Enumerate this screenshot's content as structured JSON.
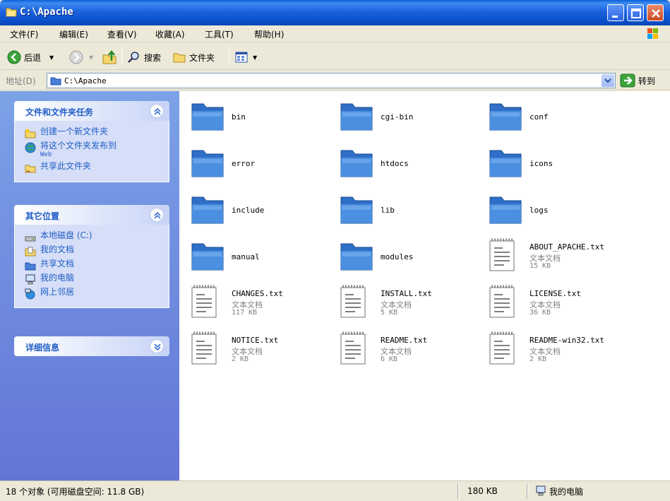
{
  "window": {
    "title": "C:\\Apache"
  },
  "menu": [
    {
      "label": "文件(F)"
    },
    {
      "label": "编辑(E)"
    },
    {
      "label": "查看(V)"
    },
    {
      "label": "收藏(A)"
    },
    {
      "label": "工具(T)"
    },
    {
      "label": "帮助(H)"
    }
  ],
  "toolbar": {
    "back_label": "后退",
    "search_label": "搜索",
    "folders_label": "文件夹"
  },
  "address": {
    "label": "地址(D)",
    "value": "C:\\Apache",
    "go_label": "转到"
  },
  "tasks_panel": {
    "title": "文件和文件夹任务",
    "items": [
      {
        "label": "创建一个新文件夹",
        "icon": "new-folder-icon"
      },
      {
        "label": "将这个文件夹发布到",
        "sub": "Web",
        "icon": "publish-web-icon"
      },
      {
        "label": "共享此文件夹",
        "icon": "share-folder-icon"
      }
    ]
  },
  "places_panel": {
    "title": "其它位置",
    "items": [
      {
        "label": "本地磁盘 (C:)",
        "icon": "local-disk-icon"
      },
      {
        "label": "我的文档",
        "icon": "my-documents-icon"
      },
      {
        "label": "共享文档",
        "icon": "shared-documents-icon"
      },
      {
        "label": "我的电脑",
        "icon": "my-computer-icon"
      },
      {
        "label": "网上邻居",
        "icon": "network-places-icon"
      }
    ]
  },
  "details_panel": {
    "title": "详细信息"
  },
  "files": [
    {
      "name": "bin",
      "kind": "folder"
    },
    {
      "name": "cgi-bin",
      "kind": "folder"
    },
    {
      "name": "conf",
      "kind": "folder"
    },
    {
      "name": "error",
      "kind": "folder"
    },
    {
      "name": "htdocs",
      "kind": "folder"
    },
    {
      "name": "icons",
      "kind": "folder"
    },
    {
      "name": "include",
      "kind": "folder"
    },
    {
      "name": "lib",
      "kind": "folder"
    },
    {
      "name": "logs",
      "kind": "folder"
    },
    {
      "name": "manual",
      "kind": "folder"
    },
    {
      "name": "modules",
      "kind": "folder"
    },
    {
      "name": "ABOUT_APACHE.txt",
      "kind": "file",
      "type": "文本文档",
      "size": "15 KB"
    },
    {
      "name": "CHANGES.txt",
      "kind": "file",
      "type": "文本文档",
      "size": "117 KB"
    },
    {
      "name": "INSTALL.txt",
      "kind": "file",
      "type": "文本文档",
      "size": "5 KB"
    },
    {
      "name": "LICENSE.txt",
      "kind": "file",
      "type": "文本文档",
      "size": "36 KB"
    },
    {
      "name": "NOTICE.txt",
      "kind": "file",
      "type": "文本文档",
      "size": "2 KB"
    },
    {
      "name": "README.txt",
      "kind": "file",
      "type": "文本文档",
      "size": "6 KB"
    },
    {
      "name": "README-win32.txt",
      "kind": "file",
      "type": "文本文档",
      "size": "2 KB"
    }
  ],
  "status": {
    "objects": "18 个对象 (可用磁盘空间: 11.8 GB)",
    "size": "180 KB",
    "location": "我的电脑"
  },
  "colors": {
    "titlebar": "#0b4fcc",
    "panel_link": "#215dc6",
    "leftpane": "#6375d6"
  }
}
